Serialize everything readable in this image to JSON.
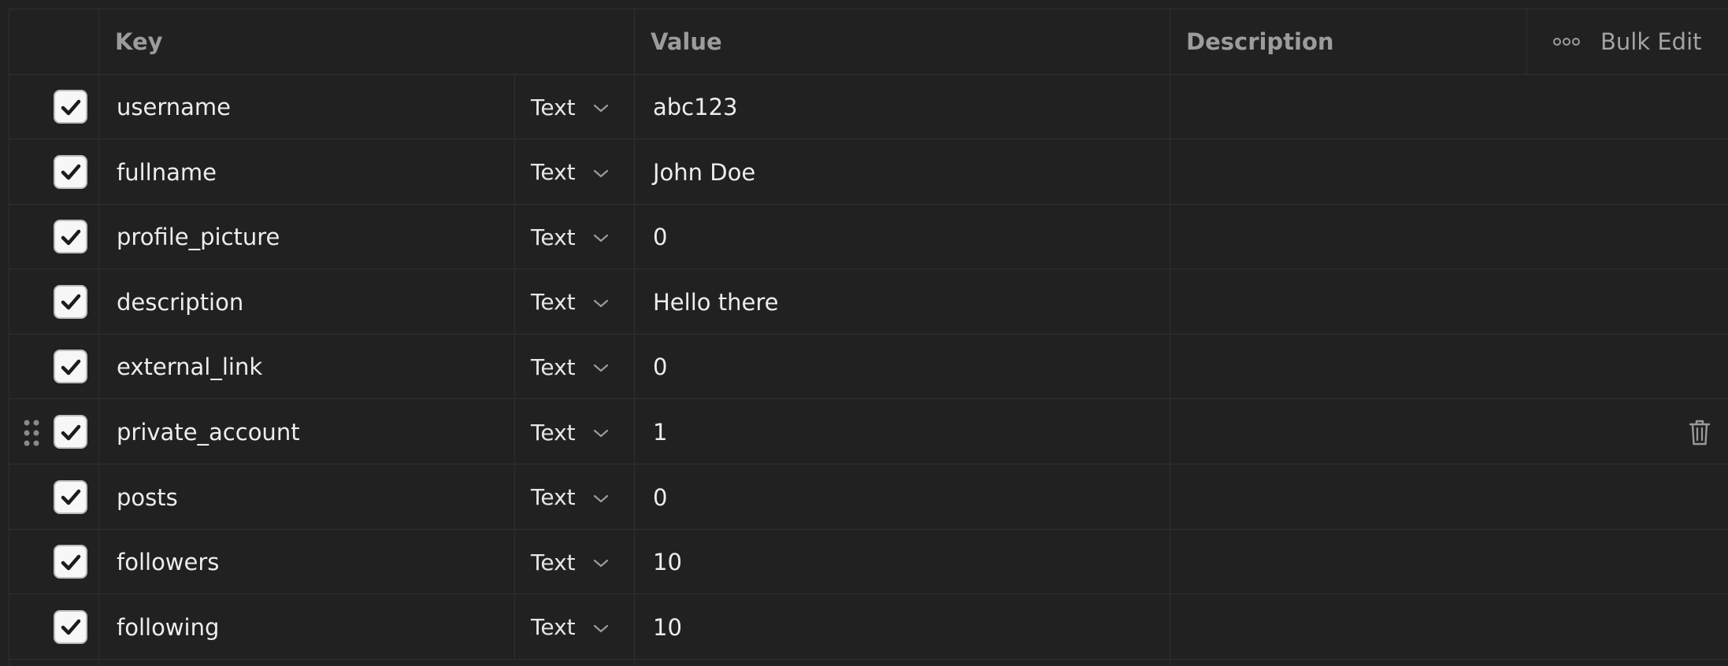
{
  "table": {
    "headers": {
      "key": "Key",
      "value": "Value",
      "description": "Description",
      "bulk_edit": "Bulk Edit"
    },
    "rows": [
      {
        "checked": true,
        "key": "username",
        "type": "Text",
        "value": "abc123",
        "description": ""
      },
      {
        "checked": true,
        "key": "fullname",
        "type": "Text",
        "value": "John Doe",
        "description": ""
      },
      {
        "checked": true,
        "key": "profile_picture",
        "type": "Text",
        "value": "0",
        "description": ""
      },
      {
        "checked": true,
        "key": "description",
        "type": "Text",
        "value": "Hello there",
        "description": ""
      },
      {
        "checked": true,
        "key": "external_link",
        "type": "Text",
        "value": "0",
        "description": ""
      },
      {
        "checked": true,
        "key": "private_account",
        "type": "Text",
        "value": "1",
        "description": "",
        "hovered": true
      },
      {
        "checked": true,
        "key": "posts",
        "type": "Text",
        "value": "0",
        "description": ""
      },
      {
        "checked": true,
        "key": "followers",
        "type": "Text",
        "value": "10",
        "description": ""
      },
      {
        "checked": true,
        "key": "following",
        "type": "Text",
        "value": "10",
        "description": ""
      }
    ]
  },
  "icons": {
    "checkbox": "checkmark-icon",
    "type_dropdown": "chevron-down-icon",
    "more": "ellipsis-icon",
    "drag": "drag-handle-icon",
    "delete": "trash-icon"
  },
  "colors": {
    "background": "#212121",
    "border": "#303030",
    "header_text": "#9c9c9c",
    "cell_text": "#ededed",
    "checkbox_bg": "#f7f7f7"
  }
}
